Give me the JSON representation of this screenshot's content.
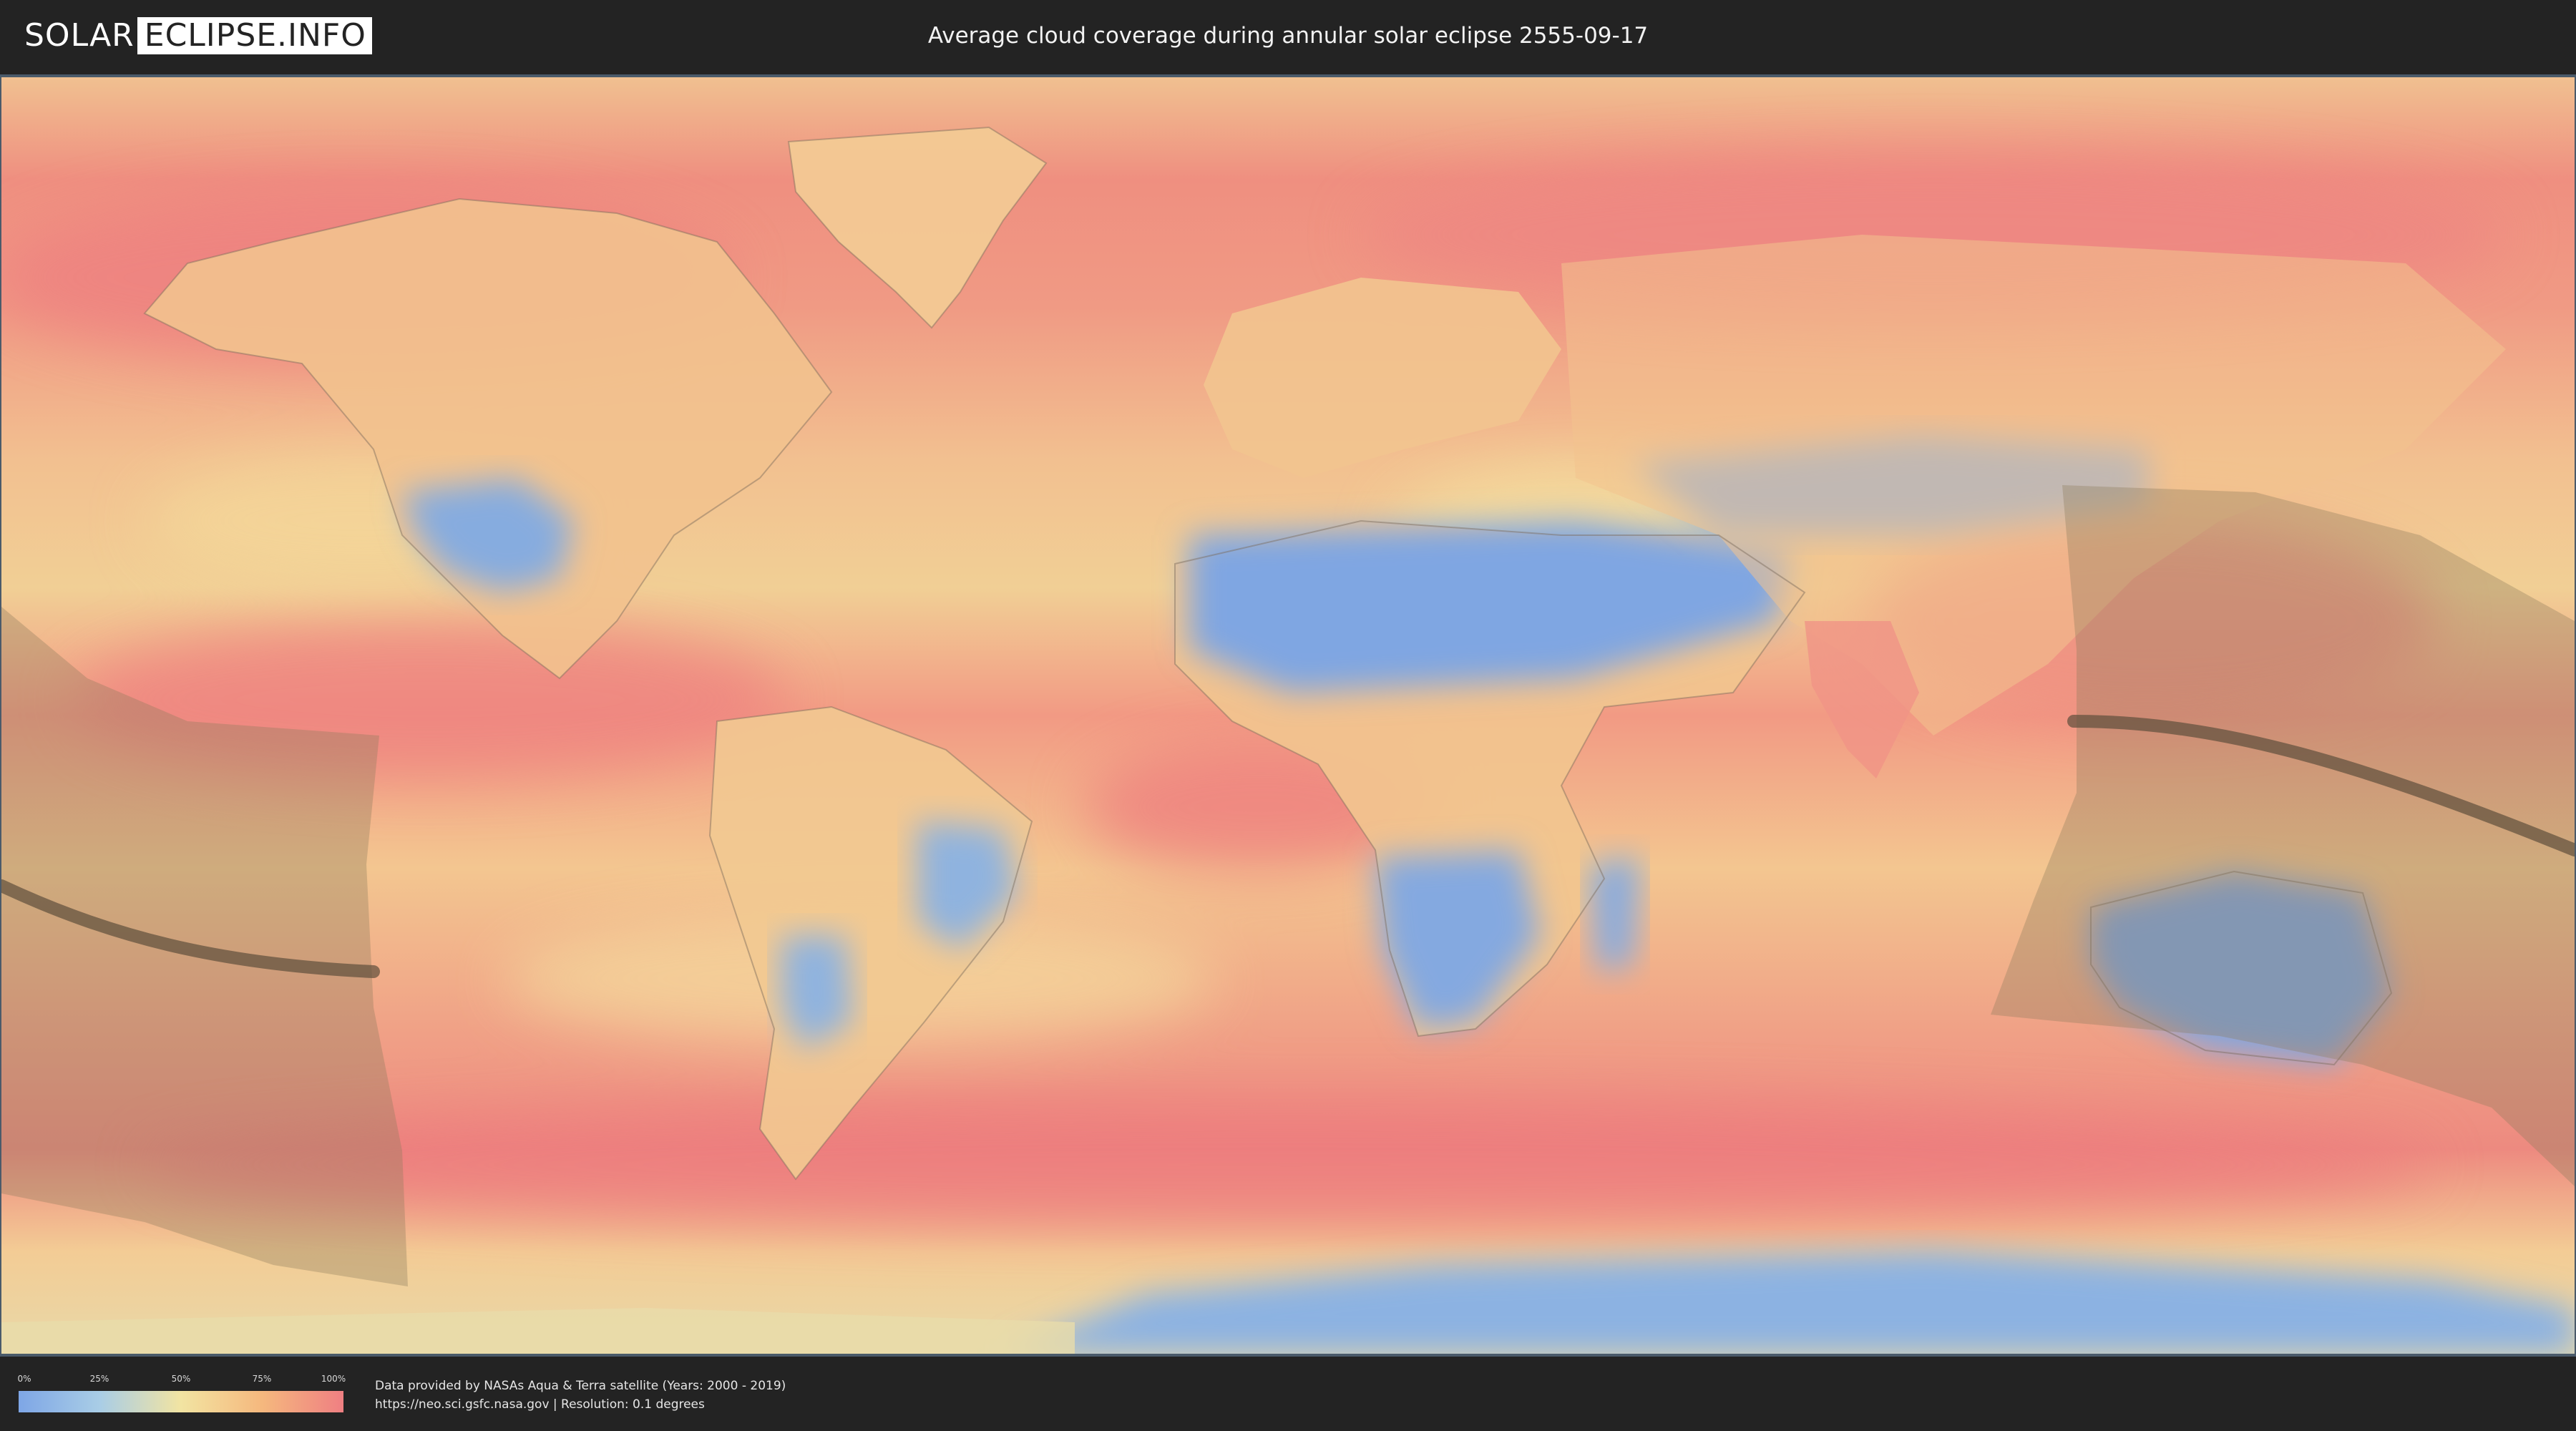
{
  "header": {
    "logo_left": "SOLAR",
    "logo_right": "ECLIPSE.INFO",
    "title": "Average cloud coverage during annular solar eclipse 2555-09-17"
  },
  "legend": {
    "ticks": [
      "0%",
      "25%",
      "50%",
      "75%",
      "100%"
    ],
    "colors": [
      "#7ea6e6",
      "#a9cde6",
      "#f2e4a2",
      "#f5b87e",
      "#ef7f82"
    ]
  },
  "footer": {
    "credit_line1": "Data provided by NASAs Aqua & Terra satellite (Years: 2000 - 2019)",
    "credit_line2": "https://neo.sci.gsfc.nasa.gov | Resolution: 0.1 degrees"
  },
  "map": {
    "projection": "equirectangular",
    "theme_colors": {
      "ocean_cloudy": "#ef8a80",
      "mid": "#f3c08a",
      "clear": "#7fa6e2",
      "eclipse_shade": "#9c8a6a",
      "eclipse_path": "#5a4a3a"
    }
  }
}
